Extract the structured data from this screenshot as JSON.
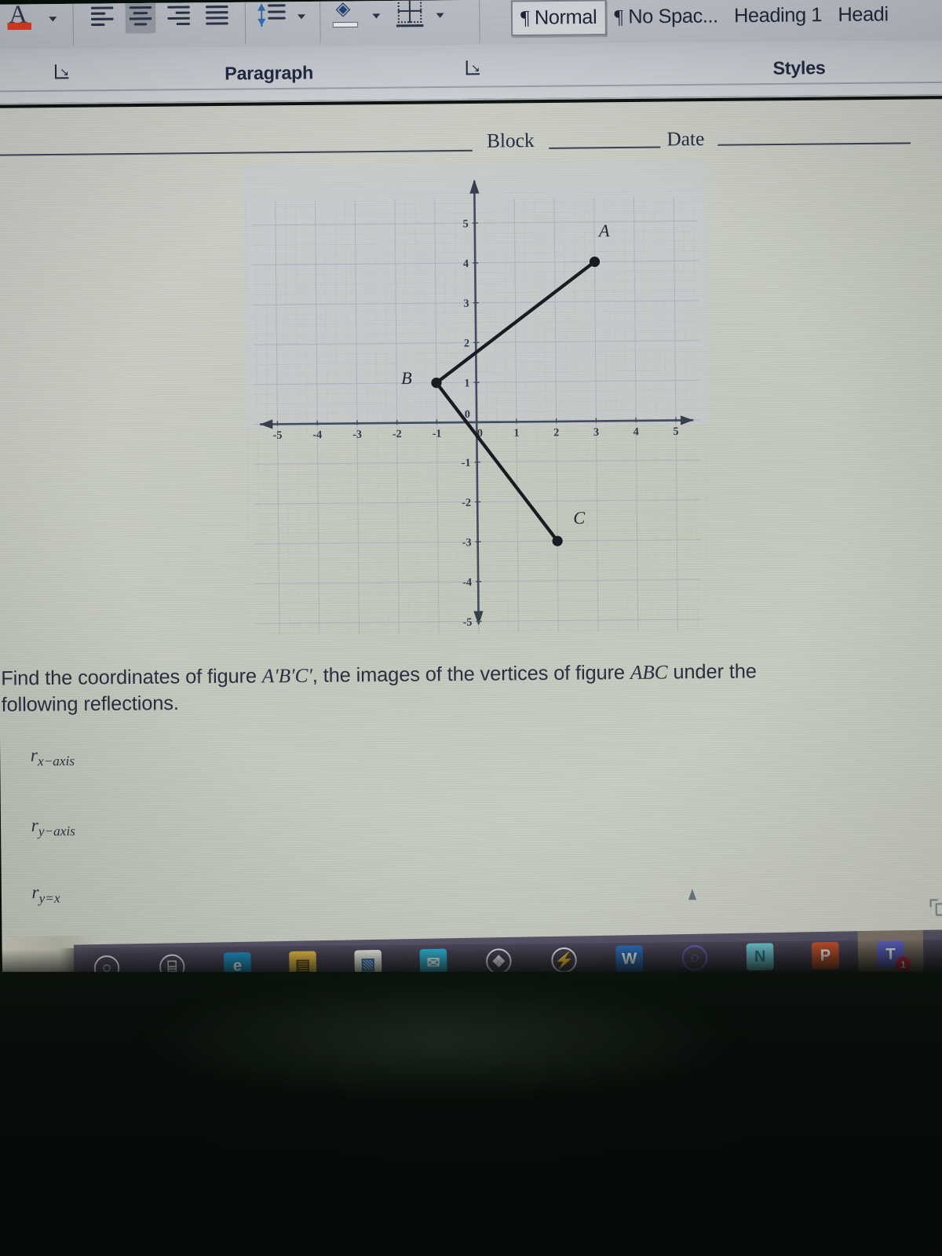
{
  "app": {
    "name": "Microsoft Word",
    "ribbon": {
      "groups": [
        {
          "label": "Paragraph",
          "launcher_left": "Paragraph options launcher",
          "launcher_right": "Paragraph options launcher 2"
        },
        {
          "label": "Styles",
          "launcher_left": "Styles options launcher"
        }
      ],
      "paragraph_buttons": [
        {
          "name": "font-color",
          "label": "Font Color",
          "swatch_color": "#e23b22"
        },
        {
          "name": "align-left",
          "label": "Align Left",
          "selected": false
        },
        {
          "name": "align-center",
          "label": "Center",
          "selected": true
        },
        {
          "name": "align-right",
          "label": "Align Right",
          "selected": false
        },
        {
          "name": "justify",
          "label": "Justify",
          "selected": false
        },
        {
          "name": "line-spacing",
          "label": "Line and Paragraph Spacing",
          "selected": false
        },
        {
          "name": "shading",
          "label": "Shading",
          "selected": false
        },
        {
          "name": "borders",
          "label": "Borders",
          "selected": false
        }
      ],
      "styles_gallery": [
        {
          "label": "Normal",
          "pilcrow": "¶",
          "selected": true
        },
        {
          "label": "No Spac...",
          "pilcrow": "¶",
          "selected": false
        },
        {
          "label": "Heading 1",
          "pilcrow": "",
          "selected": false
        },
        {
          "label": "Headi",
          "pilcrow": "",
          "selected": false
        }
      ]
    }
  },
  "document": {
    "header": {
      "block_label": "Block",
      "date_label": "Date"
    },
    "question": {
      "line1_a": "Find the coordinates of figure ",
      "line1_fig_prime": "A′B′C′",
      "line1_b": ", the images of the vertices of figure ",
      "line1_fig": "ABC",
      "line1_c": " under the",
      "line2": "following reflections."
    },
    "sub_items": [
      {
        "prefix": "r",
        "subscript": "x−axis",
        "full": "r x-axis"
      },
      {
        "prefix": "r",
        "subscript": "y−axis",
        "full": "r y-axis"
      },
      {
        "prefix": "r",
        "subscript": "y=x",
        "full": "r y=x"
      }
    ]
  },
  "chart_data": {
    "type": "scatter",
    "title": "",
    "xlabel": "",
    "ylabel": "",
    "xlim": [
      -5.6,
      5.6
    ],
    "ylim": [
      -5.6,
      5.6
    ],
    "xticks": [
      -5,
      -4,
      -3,
      -2,
      -1,
      0,
      1,
      2,
      3,
      4,
      5
    ],
    "yticks": [
      5,
      4,
      3,
      2,
      1,
      0,
      -1,
      -2,
      -3,
      -4,
      -5
    ],
    "xtick_labels": [
      "-5",
      "-4",
      "-3",
      "-2",
      "-1",
      "0",
      "1",
      "2",
      "3",
      "4",
      "5"
    ],
    "ytick_labels": [
      "5",
      "4",
      "3",
      "2",
      "1",
      "0",
      "-1",
      "-2",
      "-3",
      "-4",
      "-5"
    ],
    "grid": true,
    "grid_spacing": 1,
    "legend": "none",
    "axis_arrows": true,
    "points": [
      {
        "label": "A",
        "x": 3,
        "y": 4,
        "label_dx": 0.25,
        "label_dy": 0.75
      },
      {
        "label": "B",
        "x": -1,
        "y": 1,
        "label_dx": -0.75,
        "label_dy": 0.1
      },
      {
        "label": "C",
        "x": 2,
        "y": -3,
        "label_dx": 0.55,
        "label_dy": 0.55
      }
    ],
    "segments": [
      {
        "from": "B",
        "to": "A"
      },
      {
        "from": "B",
        "to": "C"
      }
    ],
    "series": [
      {
        "name": "figure ABC",
        "x": [
          3,
          -1,
          2
        ],
        "y": [
          4,
          1,
          -3
        ]
      }
    ]
  },
  "taskbar": {
    "items": [
      {
        "name": "search-icon",
        "glyph": "○",
        "bg": "transparent",
        "color": "#e9e9ef",
        "badge": ""
      },
      {
        "name": "task-view-icon",
        "glyph": "⌸",
        "bg": "transparent",
        "color": "#e0e0e8",
        "badge": ""
      },
      {
        "name": "edge-browser-icon",
        "glyph": "e",
        "bg": "#1b8ec2",
        "color": "#ffffff",
        "badge": ""
      },
      {
        "name": "file-explorer-icon",
        "glyph": "▤",
        "bg": "#e6bb46",
        "color": "#5a4412",
        "badge": ""
      },
      {
        "name": "microsoft-store-icon",
        "glyph": "▧",
        "bg": "#f0efe7",
        "color": "#2f6fb5",
        "badge": ""
      },
      {
        "name": "mail-icon",
        "glyph": "✉",
        "bg": "#2fb5d8",
        "color": "#ffffff",
        "badge": ""
      },
      {
        "name": "dropbox-icon",
        "glyph": "❖",
        "bg": "transparent",
        "color": "#eef0f4",
        "badge": ""
      },
      {
        "name": "lightning-icon",
        "glyph": "⚡",
        "bg": "transparent",
        "color": "#f2f2f6",
        "badge": ""
      },
      {
        "name": "word-icon",
        "glyph": "W",
        "bg": "#2a6cb8",
        "color": "#ffffff",
        "badge": ""
      },
      {
        "name": "office-icon",
        "glyph": "○",
        "bg": "transparent",
        "color": "#6b5ab8",
        "badge": ""
      },
      {
        "name": "onenote-icon",
        "glyph": "N",
        "bg": "#6fc9d6",
        "color": "#2a6f7c",
        "badge": ""
      },
      {
        "name": "powerpoint-icon",
        "glyph": "P",
        "bg": "#c7512a",
        "color": "#ffffff",
        "badge": ""
      },
      {
        "name": "teams-icon",
        "glyph": "T",
        "bg": "#5b61c4",
        "color": "#ffffff",
        "badge": "1"
      }
    ]
  }
}
